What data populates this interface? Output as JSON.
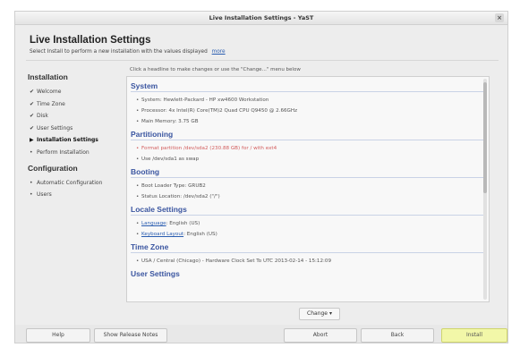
{
  "window": {
    "title": "Live Installation Settings - YaST",
    "close_glyph": "×"
  },
  "header": {
    "title": "Live Installation Settings",
    "subtitle": "Select Install to perform a new installation with the values displayed",
    "more_link": "more"
  },
  "sidebar": {
    "installation_heading": "Installation",
    "installation_items": [
      {
        "mark": "✔",
        "label": "Welcome"
      },
      {
        "mark": "✔",
        "label": "Time Zone"
      },
      {
        "mark": "✔",
        "label": "Disk"
      },
      {
        "mark": "✔",
        "label": "User Settings"
      },
      {
        "mark": "▶",
        "label": "Installation Settings"
      },
      {
        "mark": "•",
        "label": "Perform Installation"
      }
    ],
    "configuration_heading": "Configuration",
    "configuration_items": [
      {
        "mark": "•",
        "label": "Automatic Configuration"
      },
      {
        "mark": "•",
        "label": "Users"
      }
    ]
  },
  "hint": "Click a headline to make changes or use the \"Change...\" menu below",
  "sections": {
    "system": {
      "title": "System",
      "items": [
        "System: Hewlett-Packard - HP xw4600 Workstation",
        "Processor: 4x Intel(R) Core(TM)2 Quad CPU Q9450 @ 2.66GHz",
        "Main Memory: 3.75 GB"
      ]
    },
    "partitioning": {
      "title": "Partitioning",
      "items": [
        "Format partition /dev/sda2 (230.88 GB) for / with ext4",
        "Use /dev/sda1 as swap"
      ]
    },
    "booting": {
      "title": "Booting",
      "items": [
        "Boot Loader Type: GRUB2",
        "Status Location: /dev/sda2 (\"/\")"
      ]
    },
    "locale": {
      "title": "Locale Settings",
      "language_label": "Language",
      "language_value": "English (US)",
      "keyboard_label": "Keyboard Layout",
      "keyboard_value": "English (US)"
    },
    "timezone": {
      "title": "Time Zone",
      "items": [
        "USA / Central (Chicago) - Hardware Clock Set To UTC 2013-02-14 - 15:12:09"
      ]
    },
    "user_settings": {
      "title": "User Settings"
    }
  },
  "change_button": "Change",
  "buttons": {
    "help": "Help",
    "release_notes": "Show Release Notes",
    "abort": "Abort",
    "back": "Back",
    "install": "Install"
  },
  "colors": {
    "section_heading": "#3a55a0",
    "warning_text": "#d25c5c",
    "install_button": "#f2f7a8"
  }
}
